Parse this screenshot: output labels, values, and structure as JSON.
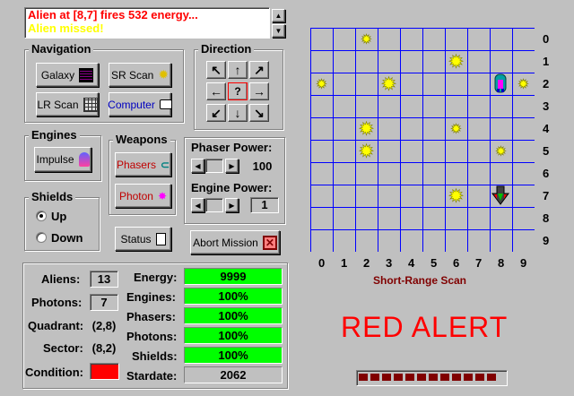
{
  "messages": {
    "line1": "Alien at [8,7] fires 532 energy...",
    "line2": "Alien missed!",
    "line1_color": "#ff0000",
    "line2_color": "#ffff00"
  },
  "navigation": {
    "title": "Navigation",
    "galaxy": "Galaxy",
    "sr_scan": "SR Scan",
    "lr_scan": "LR Scan",
    "computer": "Computer"
  },
  "direction": {
    "title": "Direction",
    "nw": "↖",
    "n": "↑",
    "ne": "↗",
    "w": "←",
    "center": "?",
    "e": "→",
    "sw": "↙",
    "s": "↓",
    "se": "↘"
  },
  "engines": {
    "title": "Engines",
    "impulse": "Impulse"
  },
  "weapons": {
    "title": "Weapons",
    "phasers": "Phasers",
    "photon": "Photon"
  },
  "phaser_power": {
    "label": "Phaser Power:",
    "value": "100"
  },
  "engine_power": {
    "label": "Engine Power:",
    "value": "1"
  },
  "shields": {
    "title": "Shields",
    "up": "Up",
    "down": "Down",
    "selected": "Up"
  },
  "status_button": "Status",
  "abort_button": "Abort Mission",
  "stats": {
    "aliens_label": "Aliens:",
    "aliens": "13",
    "photons_label": "Photons:",
    "photons": "7",
    "quadrant_label": "Quadrant:",
    "quadrant": "(2,8)",
    "sector_label": "Sector:",
    "sector": "(8,2)",
    "condition_label": "Condition:",
    "condition_color": "#ff0000"
  },
  "systems": {
    "energy_label": "Energy:",
    "energy": "9999",
    "engines_label": "Engines:",
    "engines": "100%",
    "phasers_label": "Phasers:",
    "phasers": "100%",
    "photons_label": "Photons:",
    "photons": "100%",
    "shields_label": "Shields:",
    "shields": "100%",
    "stardate_label": "Stardate:",
    "stardate": "2062"
  },
  "scan": {
    "title": "Short-Range Scan",
    "rows": [
      "0",
      "1",
      "2",
      "3",
      "4",
      "5",
      "6",
      "7",
      "8",
      "9"
    ],
    "cols": [
      "0",
      "1",
      "2",
      "3",
      "4",
      "5",
      "6",
      "7",
      "8",
      "9"
    ],
    "stars": [
      [
        2,
        0
      ],
      [
        6,
        1
      ],
      [
        0,
        2
      ],
      [
        3,
        2
      ],
      [
        9,
        2
      ],
      [
        2,
        4
      ],
      [
        6,
        4
      ],
      [
        2,
        5
      ],
      [
        8,
        5
      ],
      [
        6,
        7
      ]
    ],
    "ship": [
      8,
      2
    ],
    "alien": [
      8,
      7
    ]
  },
  "alert": {
    "text": "RED ALERT",
    "color": "#ff0000"
  },
  "colors": {
    "grid": "#0000ff",
    "bar": "#00ff00",
    "star": "#ffff00"
  }
}
